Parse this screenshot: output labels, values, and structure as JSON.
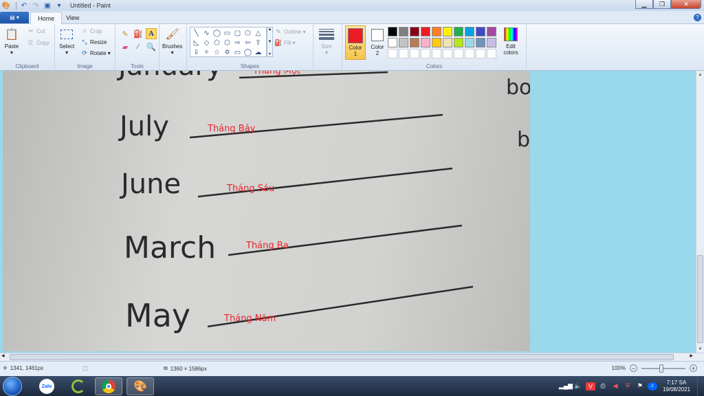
{
  "window": {
    "title": "Untitled - Paint"
  },
  "tabs": [
    {
      "label": "Home",
      "active": true
    },
    {
      "label": "View",
      "active": false
    }
  ],
  "ribbon": {
    "clipboard": {
      "group_label": "Clipboard",
      "paste": "Paste",
      "cut": "Cut",
      "copy": "Copy"
    },
    "image": {
      "group_label": "Image",
      "select": "Select",
      "crop": "Crop",
      "resize": "Resize",
      "rotate": "Rotate"
    },
    "tools": {
      "group_label": "Tools"
    },
    "brushes": {
      "label": "Brushes"
    },
    "shapes": {
      "group_label": "Shapes",
      "outline": "Outline",
      "fill": "Fill"
    },
    "size": {
      "label": "Size"
    },
    "colors": {
      "group_label": "Colors",
      "color1_label": "Color",
      "color1_num": "1",
      "color2_label": "Color",
      "color2_num": "2",
      "color1_value": "#ed1c24",
      "color2_value": "#ffffff",
      "edit_label": "Edit",
      "edit_label2": "colors",
      "palette": [
        "#000000",
        "#7f7f7f",
        "#880015",
        "#ed1c24",
        "#ff7f27",
        "#fff200",
        "#22b14c",
        "#00a2e8",
        "#3f48cc",
        "#a349a4",
        "#ffffff",
        "#c3c3c3",
        "#b97a57",
        "#ffaec9",
        "#ffc90e",
        "#efe4b0",
        "#b5e61d",
        "#99d9ea",
        "#7092be",
        "#c8bfe7",
        "#ffffff",
        "#ffffff",
        "#ffffff",
        "#ffffff",
        "#ffffff",
        "#ffffff",
        "#ffffff",
        "#ffffff",
        "#ffffff",
        "#ffffff"
      ]
    }
  },
  "canvas": {
    "words": [
      "July",
      "June",
      "March",
      "May"
    ],
    "word_top_partial": "January",
    "translations": [
      "Tháng Bảy",
      "Tháng Sáu",
      "Tháng Ba",
      "Tháng Năm"
    ],
    "translation_top_partial": "Tháng Một",
    "right_edge_fragments": [
      "bo",
      "b"
    ],
    "annotation_color": "#e8242b"
  },
  "status": {
    "cursor_pos": "1341, 1461px",
    "image_size": "1360 × 1586px",
    "zoom": "100%"
  },
  "taskbar": {
    "apps": [
      "zalo",
      "ccleaner",
      "chrome",
      "paint"
    ],
    "zalo_label": "Zalo",
    "time": "7:17 SA",
    "date": "19/08/2021"
  }
}
